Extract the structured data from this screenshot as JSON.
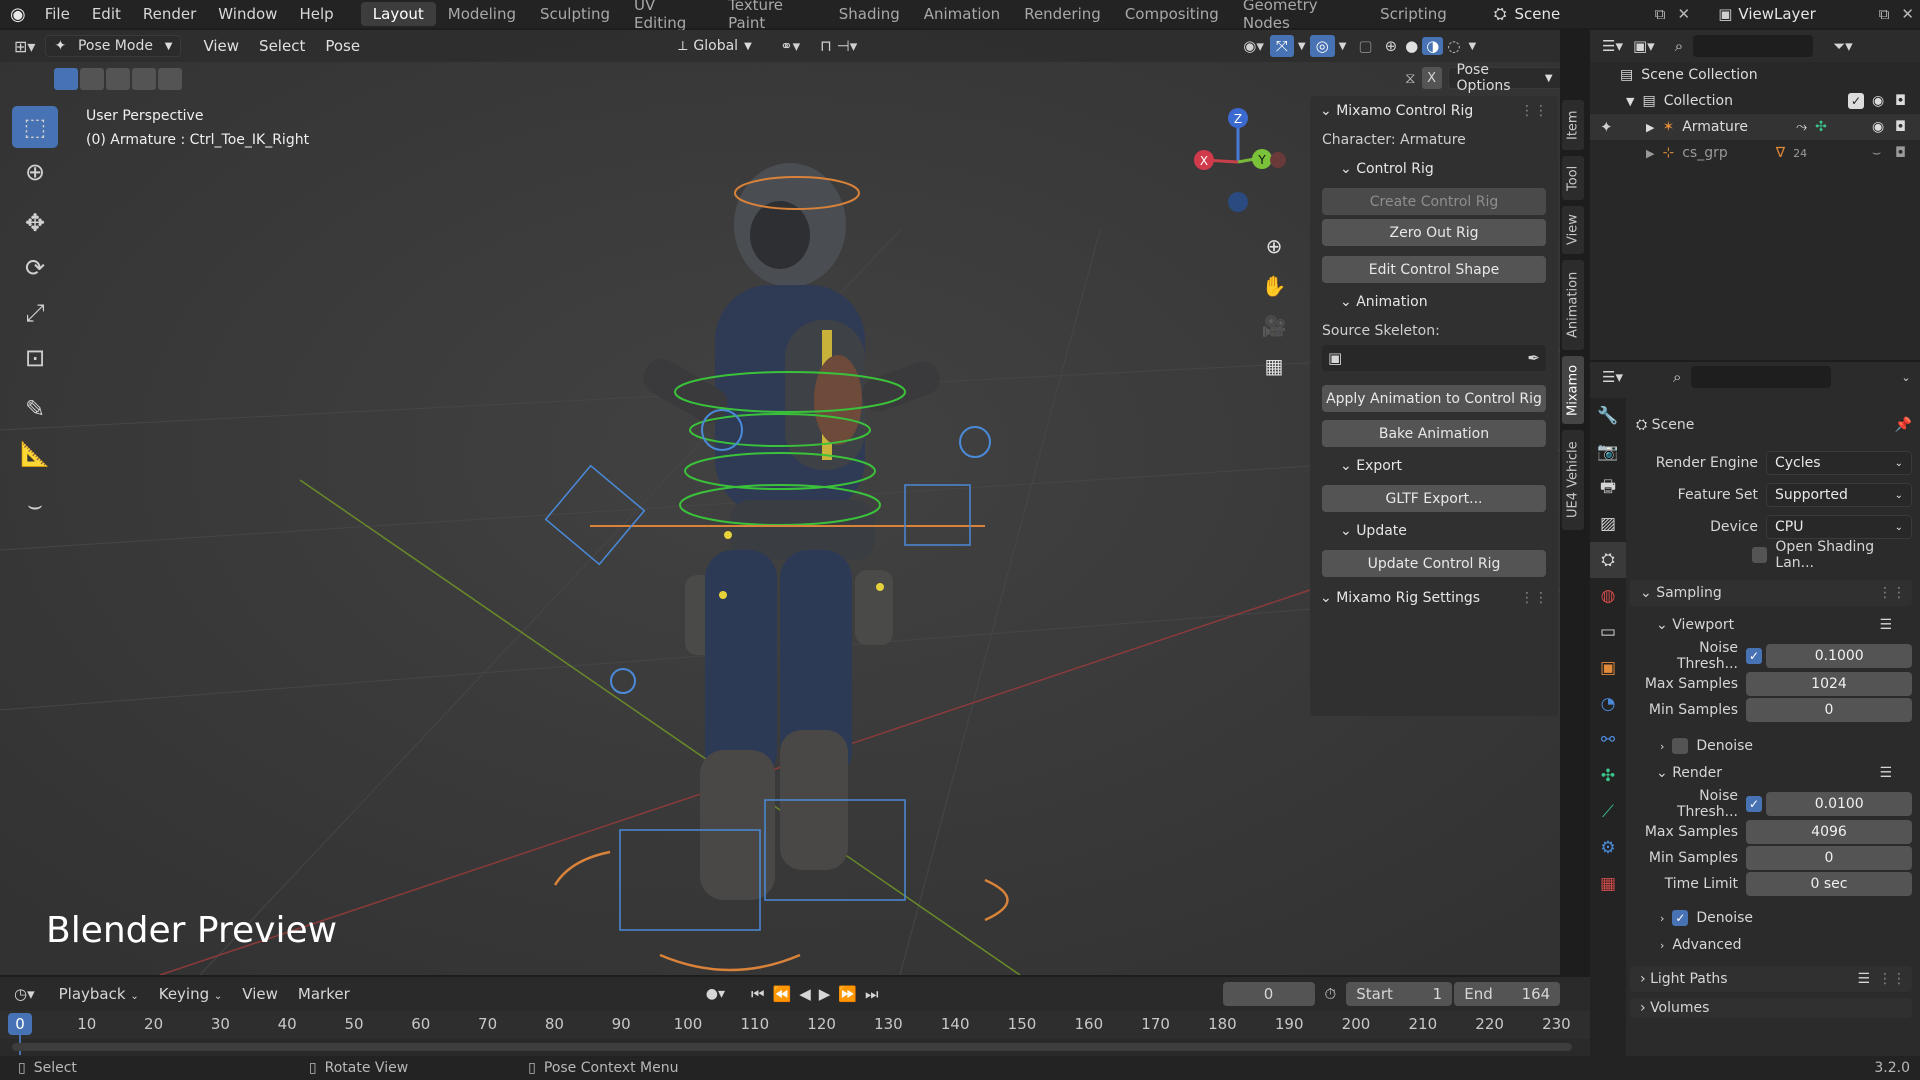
{
  "topbar": {
    "menus": [
      "File",
      "Edit",
      "Render",
      "Window",
      "Help"
    ],
    "workspaces": [
      "Layout",
      "Modeling",
      "Sculpting",
      "UV Editing",
      "Texture Paint",
      "Shading",
      "Animation",
      "Rendering",
      "Compositing",
      "Geometry Nodes",
      "Scripting"
    ],
    "active_workspace": "Layout",
    "scene_name": "Scene",
    "view_layer": "ViewLayer"
  },
  "viewport": {
    "mode": "Pose Mode",
    "menus": [
      "View",
      "Select",
      "Pose"
    ],
    "orientation": "Global",
    "pose_options": "Pose Options",
    "perspective_label": "User Perspective",
    "active_object": "(0) Armature : Ctrl_Toe_IK_Right",
    "watermark": "Blender Preview",
    "gizmo": {
      "z": "Z",
      "y": "Y",
      "x": "X"
    }
  },
  "npanel": {
    "title": "Mixamo Control Rig",
    "character": "Character: Armature",
    "control_rig_header": "Control Rig",
    "create_control_rig": "Create Control Rig",
    "zero_out_rig": "Zero Out Rig",
    "edit_control_shape": "Edit Control Shape",
    "animation_header": "Animation",
    "source_skeleton": "Source Skeleton:",
    "apply_animation": "Apply Animation to Control Rig",
    "bake_animation": "Bake Animation",
    "export_header": "Export",
    "gltf_export": "GLTF Export...",
    "update_header": "Update",
    "update_control_rig": "Update Control Rig",
    "rig_settings": "Mixamo Rig Settings",
    "tabs": [
      "Item",
      "Tool",
      "View",
      "Animation",
      "Mixamo",
      "UE4 Vehicle"
    ]
  },
  "outliner": {
    "scene_collection": "Scene Collection",
    "collection": "Collection",
    "armature": "Armature",
    "cs_grp": "cs_grp",
    "cs_count": "24"
  },
  "properties": {
    "context": "Scene",
    "render_engine_label": "Render Engine",
    "render_engine": "Cycles",
    "feature_set_label": "Feature Set",
    "feature_set": "Supported",
    "device_label": "Device",
    "device": "CPU",
    "osl_label": "Open Shading Lan...",
    "sampling": "Sampling",
    "viewport": "Viewport",
    "noise_thresh_label": "Noise Thresh...",
    "vp_noise": "0.1000",
    "max_samples_label": "Max Samples",
    "vp_max": "1024",
    "min_samples_label": "Min Samples",
    "vp_min": "0",
    "denoise": "Denoise",
    "render": "Render",
    "r_noise": "0.0100",
    "r_max": "4096",
    "r_min": "0",
    "time_limit_label": "Time Limit",
    "time_limit": "0 sec",
    "advanced": "Advanced",
    "light_paths": "Light Paths",
    "volumes": "Volumes"
  },
  "timeline": {
    "menus": [
      "Playback",
      "Keying",
      "View",
      "Marker"
    ],
    "current_frame": "0",
    "start_label": "Start",
    "start": "1",
    "end_label": "End",
    "end": "164",
    "ticks": [
      "0",
      "10",
      "20",
      "30",
      "40",
      "50",
      "60",
      "70",
      "80",
      "90",
      "100",
      "110",
      "120",
      "130",
      "140",
      "150",
      "160",
      "170",
      "180",
      "190",
      "200",
      "210",
      "220",
      "230"
    ]
  },
  "statusbar": {
    "select": "Select",
    "rotate": "Rotate View",
    "context_menu": "Pose Context Menu",
    "version": "3.2.0"
  },
  "colors": {
    "accent": "#4772b3",
    "bg": "#3b3b3b",
    "panel": "#303030"
  }
}
